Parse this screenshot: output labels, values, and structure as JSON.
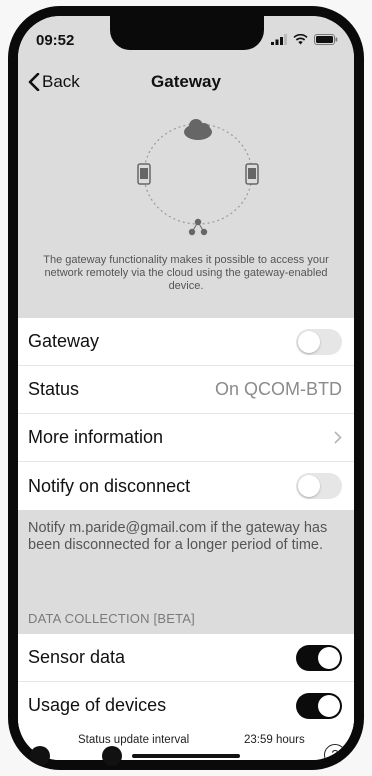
{
  "status_bar": {
    "time": "09:52"
  },
  "nav": {
    "back_label": "Back",
    "title": "Gateway"
  },
  "hero": {
    "description": "The gateway functionality makes it possible to access your network remotely via the cloud using the gateway-enabled device."
  },
  "settings": {
    "gateway": {
      "label": "Gateway",
      "enabled": false
    },
    "status": {
      "label": "Status",
      "value": "On QCOM-BTD"
    },
    "more_info": {
      "label": "More information"
    },
    "notify": {
      "label": "Notify on disconnect",
      "enabled": false
    },
    "notify_note": "Notify m.paride@gmail.com if the gateway has been disconnected for a longer period of time."
  },
  "data_collection": {
    "header": "DATA COLLECTION [BETA]",
    "sensor": {
      "label": "Sensor data",
      "enabled": true
    },
    "usage": {
      "label": "Usage of devices",
      "enabled": true
    }
  },
  "interval": {
    "label": "Status update interval",
    "value": "23:59 hours"
  },
  "help": {
    "glyph": "?"
  },
  "colors": {
    "toggle_on": "#0b0b0b",
    "toggle_off": "#e6e6e6",
    "section_bg": "#dcdcdc"
  }
}
